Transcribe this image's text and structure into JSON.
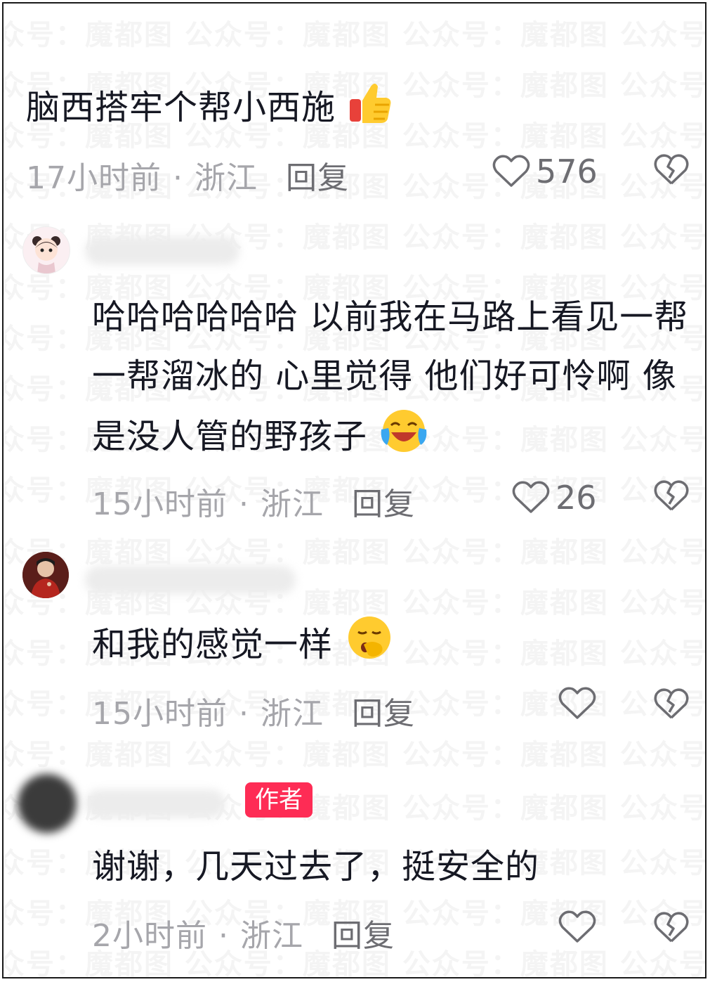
{
  "watermark": "众号：魔都图 公众号：魔都图 公众号：魔都图 公众号：魔都图",
  "comments": [
    {
      "text": "脑西搭牢个帮小西施",
      "emoji": "thumbs-up",
      "time": "17小时前",
      "location": "浙江",
      "reply": "回复",
      "likes": "576"
    },
    {
      "text": "哈哈哈哈哈哈 以前我在马路上看见一帮一帮溜冰的 心里觉得 他们好可怜啊 像是没人管的野孩子",
      "emoji": "crying-laughing",
      "time": "15小时前",
      "location": "浙江",
      "reply": "回复",
      "likes": "26"
    },
    {
      "text": "和我的感觉一样",
      "emoji": "yawning",
      "time": "15小时前",
      "location": "浙江",
      "reply": "回复",
      "likes": ""
    },
    {
      "badge": "作者",
      "text": "谢谢，几天过去了，挺安全的",
      "time": "2小时前",
      "location": "浙江",
      "reply": "回复",
      "likes": ""
    }
  ],
  "colors": {
    "text": "#161823",
    "meta": "#a6a6ab",
    "badge": "#fe2c55"
  }
}
